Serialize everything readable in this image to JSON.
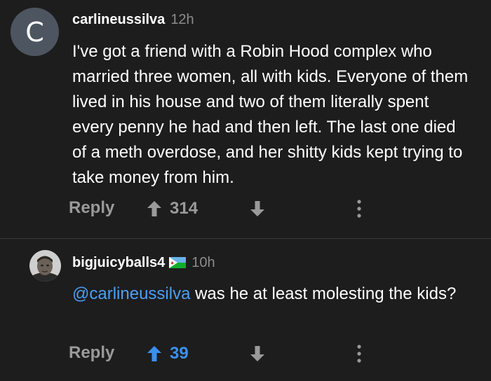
{
  "comments": [
    {
      "avatar_letter": "C",
      "username": "carlineussilva",
      "time": "12h",
      "body": "I've got a friend with a Robin Hood complex who married three women, all with kids. Everyone of them lived in his house and two of them literally spent every penny he had and then left. The last one died of a meth overdose, and her shitty kids kept trying to take money from him.",
      "reply_label": "Reply",
      "upvotes": "314",
      "upvoted": false
    },
    {
      "username": "bigjuicyballs4",
      "flag_icon": "djibouti-flag-icon",
      "time": "10h",
      "mention": "@carlineussilva",
      "body": " was he at least molesting the kids?",
      "reply_label": "Reply",
      "upvotes": "39",
      "upvoted": true
    }
  ],
  "colors": {
    "background": "#1d1d1d",
    "text": "#ffffff",
    "muted": "#9a9a9a",
    "link": "#4a9ff5",
    "upvote_active": "#3b90ef",
    "avatar_bg": "#4d5560"
  }
}
